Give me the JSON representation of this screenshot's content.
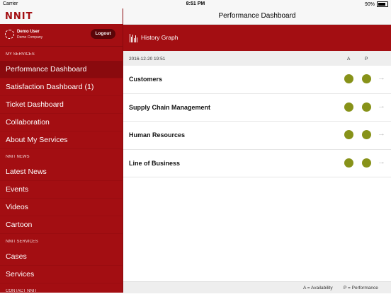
{
  "status_bar": {
    "carrier": "Carrier",
    "time": "8:51 PM",
    "battery": "90%"
  },
  "sidebar": {
    "logo": "NNIT",
    "user": {
      "name": "Demo User",
      "company": "Demo Company",
      "logout_label": "Logout"
    },
    "sections": [
      {
        "header": "MY SERVICES",
        "items": [
          "Performance Dashboard",
          "Satisfaction Dashboard (1)",
          "Ticket Dashboard",
          "Collaboration",
          "About My Services"
        ]
      },
      {
        "header": "NNIT NEWS",
        "items": [
          "Latest News",
          "Events",
          "Videos",
          "Cartoon"
        ]
      },
      {
        "header": "NNIT SERVICES",
        "items": [
          "Cases",
          "Services"
        ]
      },
      {
        "header": "CONTACT NNIT",
        "items": []
      }
    ],
    "active_item": "Performance Dashboard"
  },
  "topbar": {
    "title": "Performance Dashboard"
  },
  "graphbar": {
    "label": "History Graph",
    "icon": "bar-chart-icon"
  },
  "list": {
    "timestamp": "2016-12-20 19:51",
    "col_a": "A",
    "col_p": "P",
    "rows": [
      {
        "label": "Customers"
      },
      {
        "label": "Supply Chain Management"
      },
      {
        "label": "Human Resources"
      },
      {
        "label": "Line of Business"
      }
    ],
    "status_color": "#879219"
  },
  "footer": {
    "legend_a": "A = Availability",
    "legend_p": "P = Performance"
  }
}
